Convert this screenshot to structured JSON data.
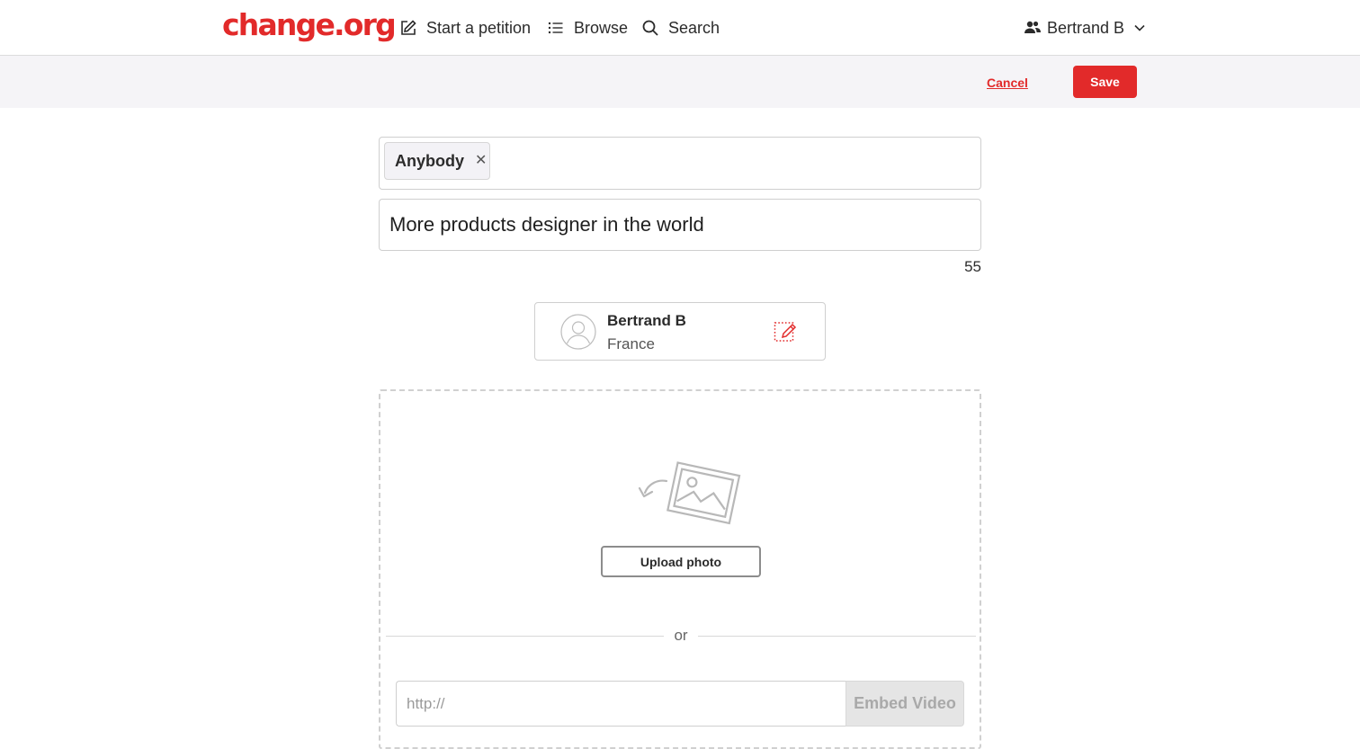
{
  "header": {
    "logo": "change.org",
    "nav": {
      "start_petition": "Start a petition",
      "browse": "Browse",
      "search": "Search"
    },
    "user": {
      "name": "Bertrand B"
    }
  },
  "actions": {
    "cancel_label": "Cancel",
    "save_label": "Save"
  },
  "form": {
    "target_chip": "Anybody",
    "title_value": "More products designer in the world",
    "char_count": "55",
    "author": {
      "name": "Bertrand B",
      "country": "France"
    },
    "media": {
      "upload_label": "Upload photo",
      "or_label": "or",
      "url_placeholder": "http://",
      "embed_label": "Embed Video"
    }
  },
  "colors": {
    "brand": "#e22a2a",
    "action_bar_bg": "#f5f4f7",
    "disabled_button_bg": "#e5e5e5"
  },
  "icons": {
    "start_petition": "pencil-square-icon",
    "browse": "list-icon",
    "search": "search-icon",
    "user": "users-icon",
    "user_menu": "chevron-down-icon",
    "chip_remove": "close-icon",
    "avatar": "user-avatar-icon",
    "edit_author": "edit-pencil-icon",
    "upload": "photo-upload-icon"
  }
}
